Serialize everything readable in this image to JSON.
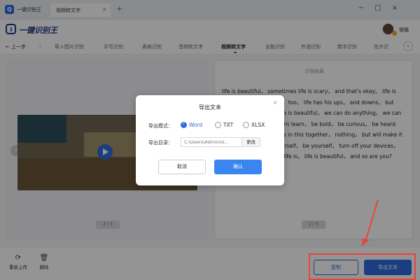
{
  "titlebar": {
    "app_title": "一键识别王",
    "tab_label": "视频转文字",
    "tab_close": "×",
    "tab_add": "+",
    "minimize": "−",
    "maximize": "□",
    "close": "×"
  },
  "header": {
    "logo_text": "一键识别王",
    "user_name": "傍晚"
  },
  "nav": {
    "back_label": "上一步",
    "separator": "|",
    "items": [
      {
        "label": "导入图片识别"
      },
      {
        "label": "手写识别"
      },
      {
        "label": "表格识别"
      },
      {
        "label": "音频转文字"
      },
      {
        "label": "视频转文字"
      },
      {
        "label": "全能识别"
      },
      {
        "label": "外语识别"
      },
      {
        "label": "数字识别"
      },
      {
        "label": "花卉识"
      }
    ],
    "more": "‹"
  },
  "left_panel": {
    "prev_arrow": "‹",
    "pager": "2 / 3"
  },
  "right_panel": {
    "title": "识别结果",
    "text": "life is beautiful， sometimes life is scary， and that's okay。 life is hard， and that's okay， too， life has his ups， and downs， but never give up ever， life is beautiful， we can do anything， we can make a difference， learn learn， be bold， be curious， be heard make your mark。 we're in this together， nothing， but will make it together， low love yourself， be yourself， turn off your devices， play， live， be life life life is， life is beautiful， and so are you?",
    "pager": "2 / 3"
  },
  "bottom": {
    "reupload_label": "重新上传",
    "delete_label": "删除",
    "copy_label": "复制",
    "export_label": "导出文本"
  },
  "dialog": {
    "title": "导出文本",
    "close": "×",
    "format_label": "导出模式：",
    "formats": [
      "Word",
      "TXT",
      "XLSX"
    ],
    "selected_format": "Word",
    "dir_label": "导出目录：",
    "dir_placeholder": "C:\\Users\\Administ...",
    "change_label": "更改",
    "cancel_label": "取消",
    "ok_label": "确认"
  },
  "colors": {
    "accent": "#2d6cdf",
    "highlight": "#e8443a"
  }
}
